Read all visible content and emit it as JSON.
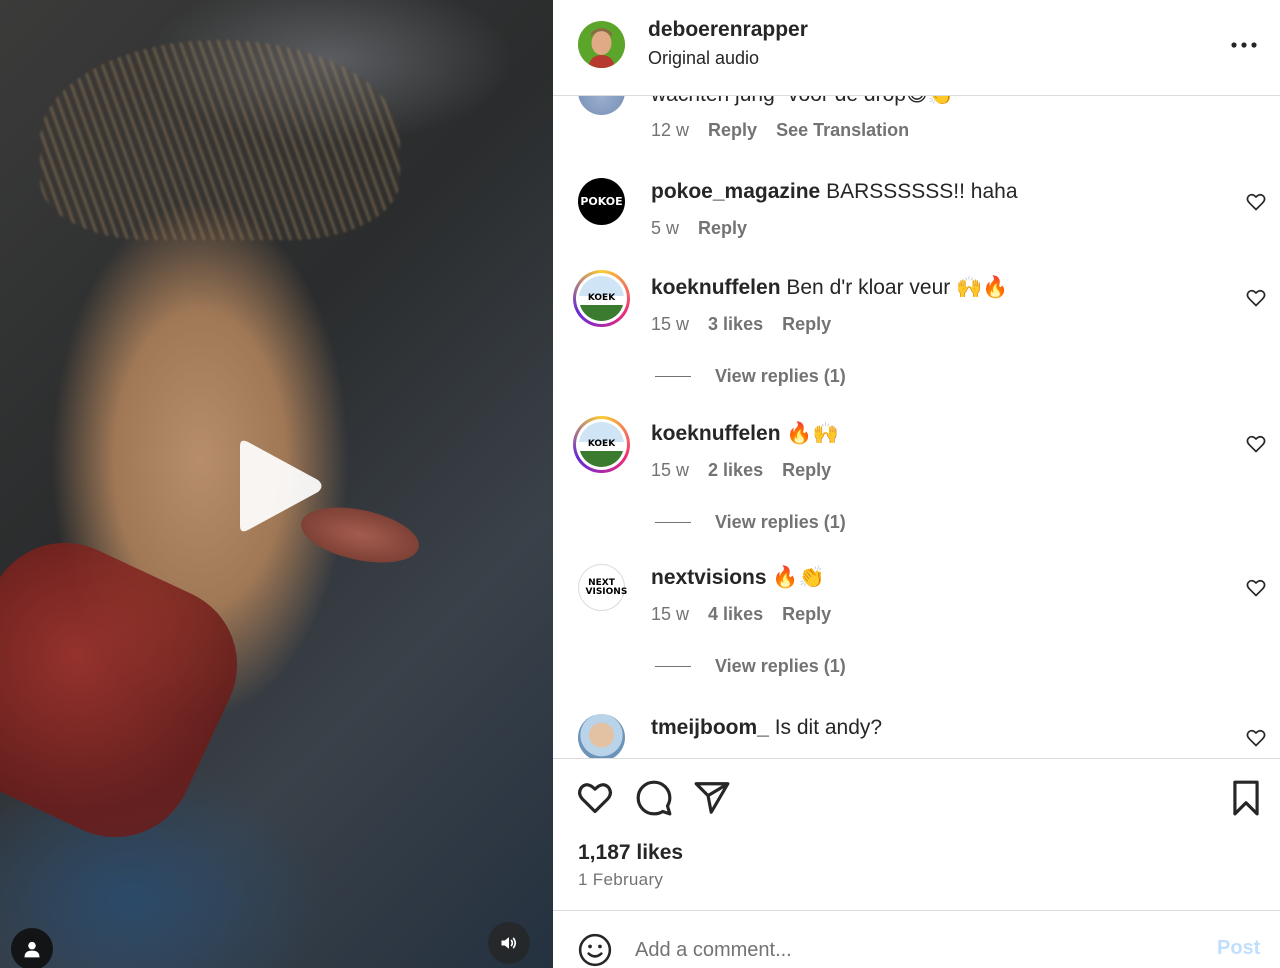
{
  "post": {
    "username": "deboerenrapper",
    "audio": "Original audio"
  },
  "colors": {
    "link_blue_disabled": "#c0dffd",
    "secondary_text": "#737373",
    "primary_text": "#262626",
    "border": "#dbdbdb"
  },
  "comments": [
    {
      "text": "wachten jung \"voor de drop😅👏",
      "time": "12 w",
      "reply": "Reply",
      "translate": "See Translation"
    },
    {
      "avatar_text": "POKOE",
      "user": "pokoe_magazine",
      "text": " BARSSSSSS!! haha",
      "time": "5 w",
      "reply": "Reply"
    },
    {
      "avatar_text": "KOEK",
      "user": "koeknuffelen",
      "text": " Ben d'r kloar veur 🙌🔥",
      "time": "15 w",
      "likes": "3 likes",
      "reply": "Reply",
      "view_replies": "View replies (1)"
    },
    {
      "avatar_text": "KOEK",
      "user": "koeknuffelen",
      "text": " 🔥🙌",
      "time": "15 w",
      "likes": "2 likes",
      "reply": "Reply",
      "view_replies": "View replies (1)"
    },
    {
      "avatar_text": "NEXT VISIONS",
      "user": "nextvisions",
      "text": " 🔥👏",
      "time": "15 w",
      "likes": "4 likes",
      "reply": "Reply",
      "view_replies": "View replies (1)"
    },
    {
      "user": "tmeijboom_",
      "text": " Is dit andy?"
    }
  ],
  "actions": {
    "likes": "1,187 likes",
    "date": "1 February"
  },
  "composer": {
    "placeholder": "Add a comment...",
    "post_label": "Post"
  },
  "icons": {
    "play": "play-icon",
    "sound": "speaker-icon",
    "tag": "user-icon",
    "more": "more-icon",
    "like": "heart-icon",
    "comment": "comment-icon",
    "share": "send-icon",
    "save": "bookmark-icon",
    "emoji": "emoji-icon"
  }
}
